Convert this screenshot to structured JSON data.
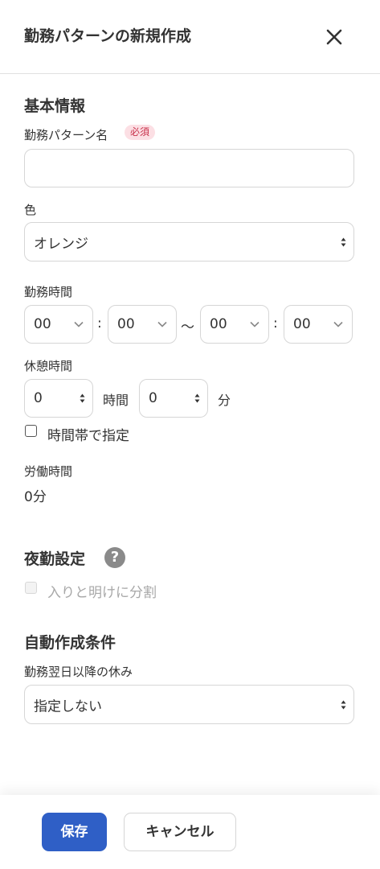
{
  "header": {
    "title": "勤務パターンの新規作成"
  },
  "basic_info": {
    "section_title": "基本情報",
    "pattern_name_label": "勤務パターン名",
    "required_badge": "必須",
    "pattern_name_value": "",
    "color_label": "色",
    "color_value": "オレンジ",
    "work_time_label": "勤務時間",
    "work_time": {
      "start_hour": "00",
      "start_minute": "00",
      "end_hour": "00",
      "end_minute": "00",
      "colon": ":",
      "tilde": "〜"
    },
    "break_time_label": "休憩時間",
    "break_hours_value": "0",
    "break_hours_unit": "時間",
    "break_minutes_value": "0",
    "break_minutes_unit": "分",
    "time_range_checkbox_label": "時間帯で指定",
    "time_range_checked": false,
    "labor_time_label": "労働時間",
    "labor_time_value": "0分"
  },
  "night_shift": {
    "section_title": "夜勤設定",
    "help_icon_glyph": "?",
    "split_checkbox_label": "入りと明けに分割",
    "split_checked": false,
    "split_disabled": true
  },
  "auto_create": {
    "section_title": "自動作成条件",
    "rest_label": "勤務翌日以降の休み",
    "rest_value": "指定しない"
  },
  "footer": {
    "save_label": "保存",
    "cancel_label": "キャンセル"
  },
  "colors": {
    "primary": "#2f5fc6",
    "required_badge_bg": "#fcdfe4",
    "required_badge_text": "#c8314b",
    "help_icon": "#8a8a8a"
  }
}
